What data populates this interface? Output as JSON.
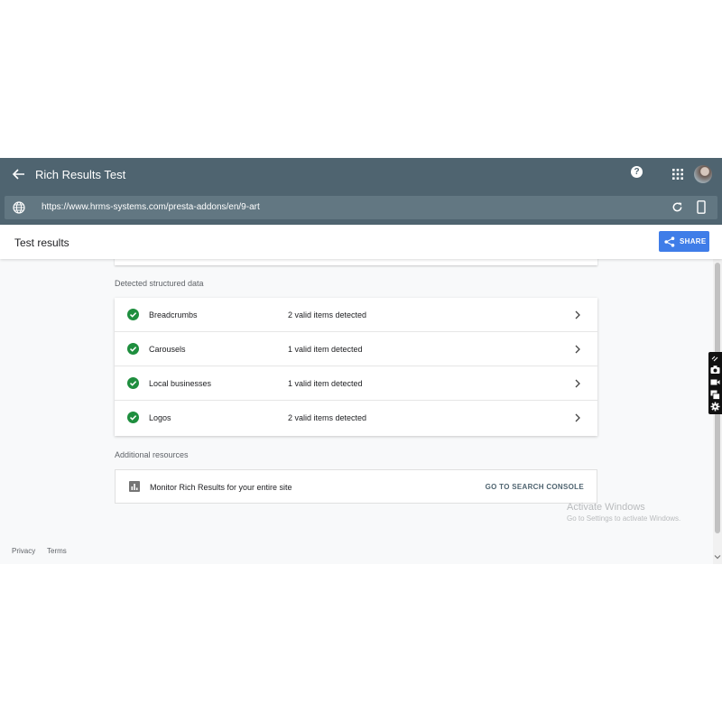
{
  "app": {
    "title": "Rich Results Test",
    "url": "https://www.hrms-systems.com/presta-addons/en/9-art"
  },
  "results": {
    "title": "Test results",
    "share_label": "SHARE"
  },
  "detected": {
    "label": "Detected structured data",
    "items": [
      {
        "name": "Breadcrumbs",
        "status": "2 valid items detected"
      },
      {
        "name": "Carousels",
        "status": "1 valid item detected"
      },
      {
        "name": "Local businesses",
        "status": "1 valid item detected"
      },
      {
        "name": "Logos",
        "status": "2 valid items detected"
      }
    ]
  },
  "additional": {
    "label": "Additional resources",
    "resource_text": "Monitor Rich Results for your entire site",
    "link_label": "GO TO SEARCH CONSOLE"
  },
  "watermark": {
    "title": "Activate Windows",
    "subtitle": "Go to Settings to activate Windows."
  },
  "footer": {
    "privacy": "Privacy",
    "terms": "Terms"
  },
  "colors": {
    "topbar": "#4f6470",
    "share": "#3f7de8",
    "check": "#1e8e3e"
  }
}
